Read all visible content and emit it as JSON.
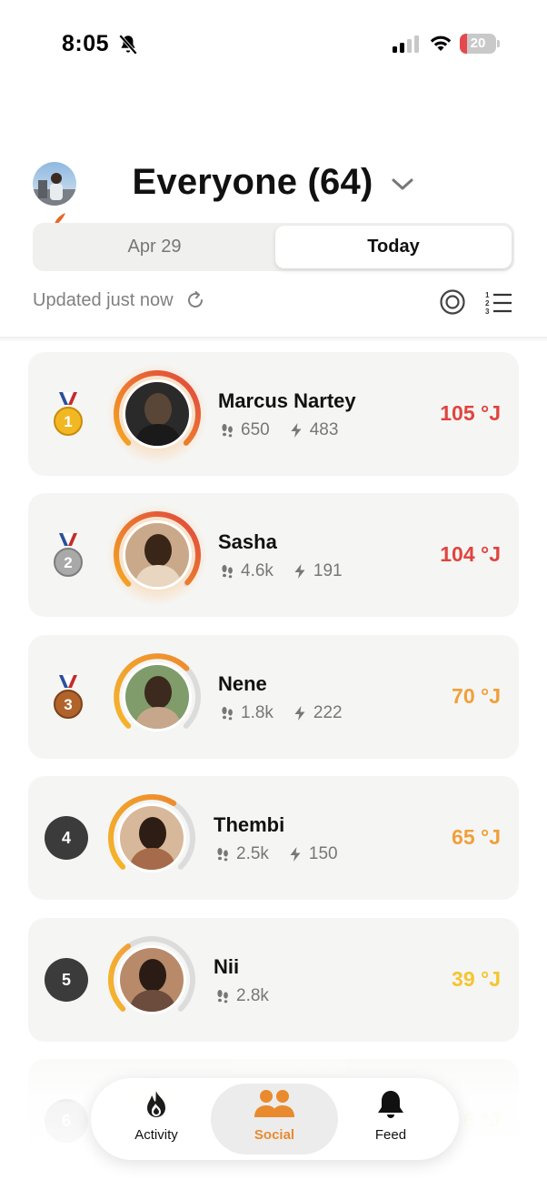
{
  "status_bar": {
    "time": "8:05",
    "battery": "20",
    "battery_level": 0.2
  },
  "header": {
    "title": "Everyone (64)"
  },
  "date_tabs": {
    "left": "Apr 29",
    "right": "Today",
    "selected": "Today"
  },
  "updated": {
    "text": "Updated just now"
  },
  "leaderboard": [
    {
      "rank": "1",
      "name": "Marcus Nartey",
      "steps": "650",
      "energy": "483",
      "score": "105 °J",
      "score_color": "#e0443e",
      "ring_level": 1.0
    },
    {
      "rank": "2",
      "name": "Sasha",
      "steps": "4.6k",
      "energy": "191",
      "score": "104 °J",
      "score_color": "#e0443e",
      "ring_level": 0.99
    },
    {
      "rank": "3",
      "name": "Nene",
      "steps": "1.8k",
      "energy": "222",
      "score": "70 °J",
      "score_color": "#f0a03a",
      "ring_level": 0.67
    },
    {
      "rank": "4",
      "name": "Thembi",
      "steps": "2.5k",
      "energy": "150",
      "score": "65 °J",
      "score_color": "#f0a03a",
      "ring_level": 0.62
    },
    {
      "rank": "5",
      "name": "Nii",
      "steps": "2.8k",
      "energy": "",
      "score": "39 °J",
      "score_color": "#f5c530",
      "ring_level": 0.37
    },
    {
      "rank": "6",
      "name": "",
      "steps": "",
      "energy": "",
      "score": "6 °J",
      "score_color": "#f5c530",
      "ring_level": 0.3
    }
  ],
  "nav": {
    "activity": "Activity",
    "social": "Social",
    "feed": "Feed",
    "active": "Social",
    "accent": "#e98a2f"
  }
}
